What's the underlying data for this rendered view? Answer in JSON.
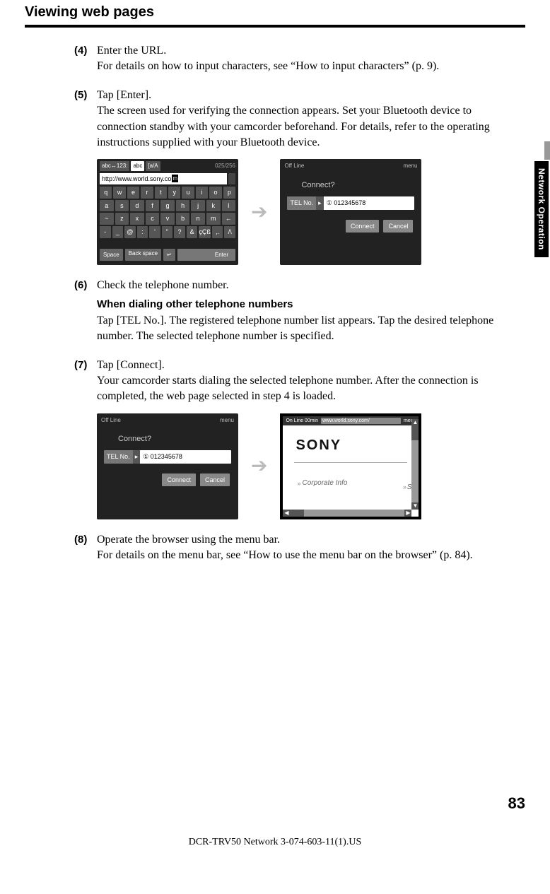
{
  "header": {
    "title": "Viewing web pages"
  },
  "side_tab": "Network Operation",
  "page_number": "83",
  "footer": "DCR-TRV50 Network 3-074-603-11(1).US",
  "steps": {
    "s4": {
      "num": "(4)",
      "first": "Enter the URL.",
      "rest": "For details on how to input characters, see “How to input characters” (p. 9)."
    },
    "s5": {
      "num": "(5)",
      "first": "Tap [Enter].",
      "rest": "The screen used for verifying the connection appears. Set your Bluetooth device to connection standby with your camcorder beforehand. For details, refer to the operating instructions supplied with your Bluetooth device."
    },
    "s6": {
      "num": "(6)",
      "first": "Check the telephone number.",
      "sub_heading": "When dialing other telephone numbers",
      "sub_text": "Tap [TEL No.]. The registered telephone number list appears. Tap the desired telephone number. The selected telephone number is specified."
    },
    "s7": {
      "num": "(7)",
      "first": "Tap [Connect].",
      "rest": "Your camcorder starts dialing the selected telephone number. After the connection is completed, the web page selected in step 4 is loaded."
    },
    "s8": {
      "num": "(8)",
      "first": "Operate the browser using the menu bar.",
      "rest": "For details on the menu bar, see “How to use the menu bar on the browser” (p. 84)."
    }
  },
  "kb": {
    "tab1": "abc↔123:",
    "tab2": "abc",
    "tab3": "[a/A",
    "count": "025/256",
    "url": "http://www.world.sony.co",
    "url_caret": "m",
    "row1": [
      "q",
      "w",
      "e",
      "r",
      "t",
      "y",
      "u",
      "i",
      "o",
      "p"
    ],
    "row2": [
      "a",
      "s",
      "d",
      "f",
      "g",
      "h",
      "j",
      "k",
      "l"
    ],
    "row3": [
      "~",
      "z",
      "x",
      "c",
      "v",
      "b",
      "n",
      "m",
      "←"
    ],
    "row4": [
      "-",
      "_",
      "@",
      ":",
      "'",
      "\"",
      "?",
      "&",
      "çÇß",
      ",.",
      "/\\"
    ],
    "space": "Space",
    "backspace": "Back space",
    "return": "↵",
    "enter": "Enter"
  },
  "connect": {
    "status": "Off Line",
    "menu": "menu",
    "msg": "Connect?",
    "tel_label": "TEL No.",
    "tel_arrow": "▸",
    "tel_value": "① 012345678",
    "btn1": "Connect",
    "btn2": "Cancel"
  },
  "sony": {
    "status": "On Line 00min",
    "url": "www.world.sony.com/",
    "menu": "menu",
    "logo": "SONY",
    "link": "Corporate Info",
    "link2": "S"
  },
  "arrow": "➔"
}
